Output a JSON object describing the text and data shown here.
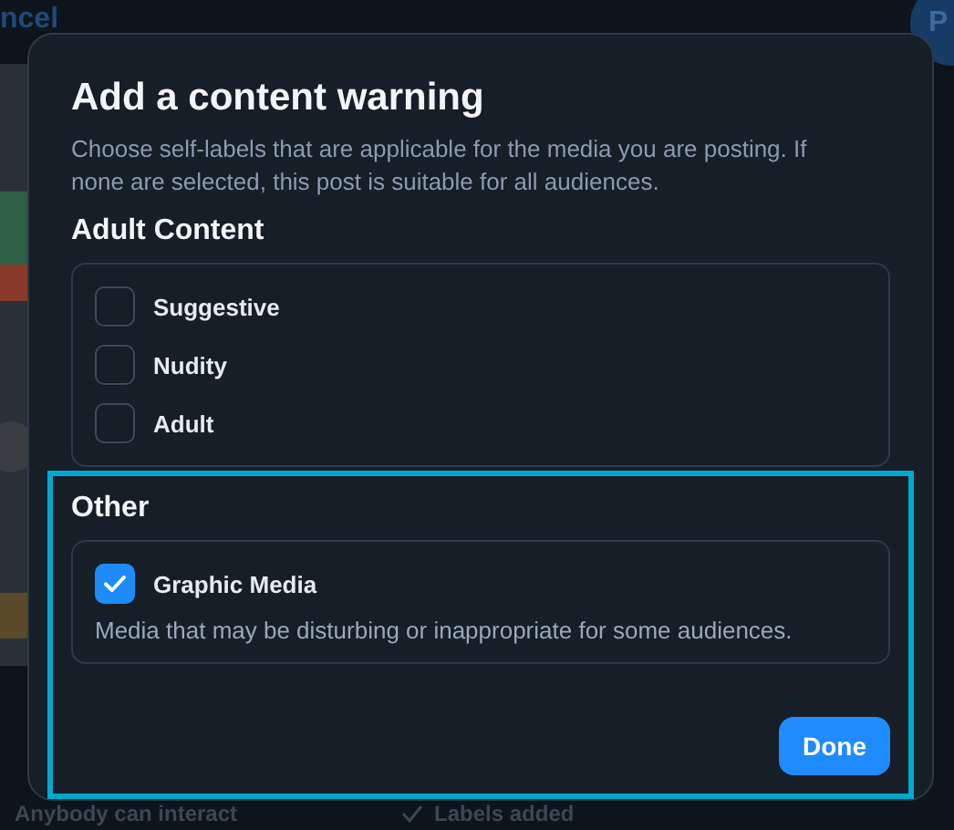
{
  "background": {
    "cancel_link": "ncel",
    "post_button": "P",
    "footer": {
      "interaction": "Anybody can interact",
      "labels_status": "Labels added"
    }
  },
  "dialog": {
    "title": "Add a content warning",
    "description": "Choose self-labels that are applicable for the media you are posting. If none are selected, this post is suitable for all audiences.",
    "sections": [
      {
        "title": "Adult Content",
        "highlighted": false,
        "options": [
          {
            "label": "Suggestive",
            "checked": false
          },
          {
            "label": "Nudity",
            "checked": false
          },
          {
            "label": "Adult",
            "checked": false
          }
        ]
      },
      {
        "title": "Other",
        "highlighted": true,
        "options": [
          {
            "label": "Graphic Media",
            "checked": true,
            "description": "Media that may be disturbing or inappropriate for some audiences."
          }
        ]
      }
    ],
    "done_button": "Done"
  }
}
